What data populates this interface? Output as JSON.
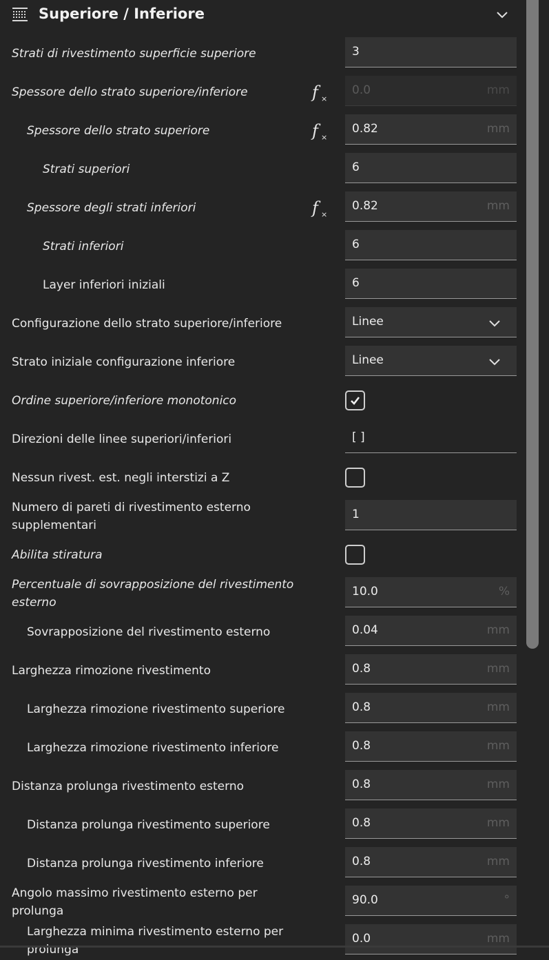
{
  "section": {
    "title": "Superiore / Inferiore",
    "icon": "layers-icon",
    "collapse_icon": "chevron-down-icon"
  },
  "rows": [
    {
      "label": "Strati di rivestimento superficie superiore",
      "italic": true,
      "indent": 0,
      "type": "number",
      "value": "3",
      "unit": ""
    },
    {
      "label": "Spessore dello strato superiore/inferiore",
      "italic": true,
      "indent": 0,
      "type": "number",
      "value": "0.0",
      "unit": "mm",
      "fx": true,
      "disabled": true
    },
    {
      "label": "Spessore dello strato superiore",
      "italic": true,
      "indent": 1,
      "type": "number",
      "value": "0.82",
      "unit": "mm",
      "fx": true
    },
    {
      "label": "Strati superiori",
      "italic": true,
      "indent": 2,
      "type": "number",
      "value": "6",
      "unit": ""
    },
    {
      "label": "Spessore degli strati inferiori",
      "italic": true,
      "indent": 1,
      "type": "number",
      "value": "0.82",
      "unit": "mm",
      "fx": true
    },
    {
      "label": "Strati inferiori",
      "italic": true,
      "indent": 2,
      "type": "number",
      "value": "6",
      "unit": ""
    },
    {
      "label": "Layer inferiori iniziali",
      "italic": false,
      "indent": 2,
      "type": "number",
      "value": "6",
      "unit": ""
    },
    {
      "label": "Configurazione dello strato superiore/inferiore",
      "italic": false,
      "indent": 0,
      "type": "select",
      "value": "Linee"
    },
    {
      "label": "Strato iniziale configurazione inferiore",
      "italic": false,
      "indent": 0,
      "type": "select",
      "value": "Linee"
    },
    {
      "label": "Ordine superiore/inferiore monotonico",
      "italic": true,
      "indent": 0,
      "type": "checkbox",
      "checked": true
    },
    {
      "label": "Direzioni delle linee superiori/inferiori",
      "italic": false,
      "indent": 0,
      "type": "text",
      "value": "[ ]"
    },
    {
      "label": "Nessun rivest. est. negli interstizi a Z",
      "italic": false,
      "indent": 0,
      "type": "checkbox",
      "checked": false
    },
    {
      "label": [
        "Numero di pareti di rivestimento esterno",
        "supplementari"
      ],
      "italic": false,
      "indent": 0,
      "type": "number",
      "value": "1",
      "unit": ""
    },
    {
      "label": "Abilita stiratura",
      "italic": true,
      "indent": 0,
      "type": "checkbox",
      "checked": false
    },
    {
      "label": [
        "Percentuale di sovrapposizione del rivestimento",
        "esterno"
      ],
      "italic": true,
      "indent": 0,
      "type": "number",
      "value": "10.0",
      "unit": "%"
    },
    {
      "label": "Sovrapposizione del rivestimento esterno",
      "italic": false,
      "indent": 1,
      "type": "number",
      "value": "0.04",
      "unit": "mm"
    },
    {
      "label": "Larghezza rimozione rivestimento",
      "italic": false,
      "indent": 0,
      "type": "number",
      "value": "0.8",
      "unit": "mm"
    },
    {
      "label": "Larghezza rimozione rivestimento superiore",
      "italic": false,
      "indent": 1,
      "type": "number",
      "value": "0.8",
      "unit": "mm"
    },
    {
      "label": "Larghezza rimozione rivestimento inferiore",
      "italic": false,
      "indent": 1,
      "type": "number",
      "value": "0.8",
      "unit": "mm"
    },
    {
      "label": "Distanza prolunga rivestimento esterno",
      "italic": false,
      "indent": 0,
      "type": "number",
      "value": "0.8",
      "unit": "mm"
    },
    {
      "label": "Distanza prolunga rivestimento superiore",
      "italic": false,
      "indent": 1,
      "type": "number",
      "value": "0.8",
      "unit": "mm"
    },
    {
      "label": "Distanza prolunga rivestimento inferiore",
      "italic": false,
      "indent": 1,
      "type": "number",
      "value": "0.8",
      "unit": "mm"
    },
    {
      "label": [
        "Angolo massimo rivestimento esterno per",
        "prolunga"
      ],
      "italic": false,
      "indent": 0,
      "type": "number",
      "value": "90.0",
      "unit": "°"
    },
    {
      "label": [
        "Larghezza minima rivestimento esterno per",
        "prolunga"
      ],
      "italic": false,
      "indent": 1,
      "type": "number",
      "value": "0.0",
      "unit": "mm"
    }
  ]
}
